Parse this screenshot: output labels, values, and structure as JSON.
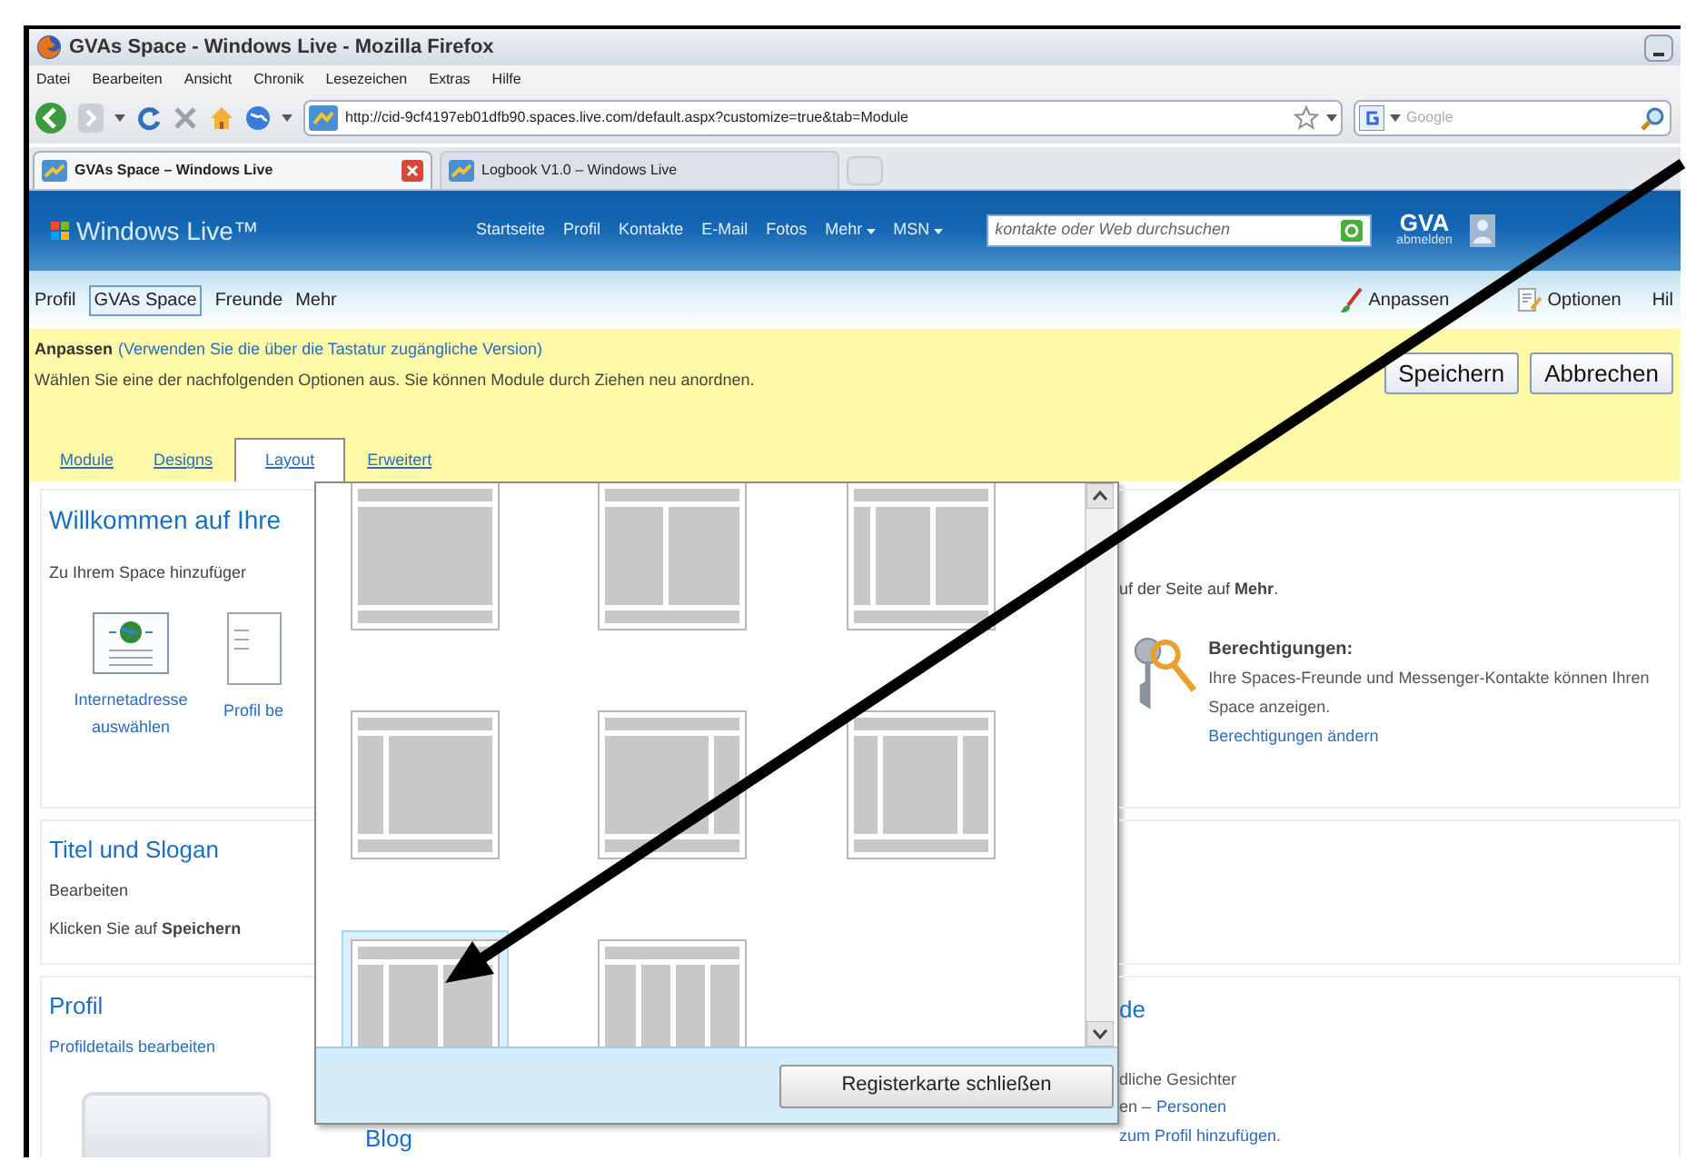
{
  "window": {
    "title": "GVAs Space - Windows Live - Mozilla Firefox"
  },
  "menu": [
    "Datei",
    "Bearbeiten",
    "Ansicht",
    "Chronik",
    "Lesezeichen",
    "Extras",
    "Hilfe"
  ],
  "address_bar": {
    "value": "http://cid-9cf4197eb01dfb90.spaces.live.com/default.aspx?customize=true&tab=Module"
  },
  "search_box": {
    "placeholder": "Google"
  },
  "browser_tabs": [
    {
      "label": "GVAs Space – Windows Live",
      "selected": true
    },
    {
      "label": "Logbook V1.0 – Windows Live",
      "selected": false
    }
  ],
  "site_header": {
    "logo": "Windows Live™",
    "nav": [
      {
        "label": "Startseite",
        "dropdown": false
      },
      {
        "label": "Profil",
        "dropdown": false
      },
      {
        "label": "Kontakte",
        "dropdown": false
      },
      {
        "label": "E-Mail",
        "dropdown": false
      },
      {
        "label": "Fotos",
        "dropdown": false
      },
      {
        "label": "Mehr",
        "dropdown": true
      },
      {
        "label": "MSN",
        "dropdown": true
      }
    ],
    "search": {
      "placeholder": "kontakte oder Web durchsuchen"
    },
    "user": "GVA",
    "signout": "abmelden"
  },
  "space_nav": {
    "items": [
      {
        "label": "Profil",
        "selected": false
      },
      {
        "label": "GVAs Space",
        "selected": true
      },
      {
        "label": "Freunde",
        "selected": false
      },
      {
        "label": "Mehr",
        "selected": false
      }
    ],
    "tools": [
      {
        "kind": "brush",
        "label": "Anpassen"
      },
      {
        "kind": "options",
        "label": "Optionen"
      },
      {
        "kind": "plain",
        "label": "Hil"
      }
    ]
  },
  "customize_bar": {
    "title": "Anpassen",
    "link": "(Verwenden Sie die über die Tastatur zugängliche Version)",
    "hint": "Wählen Sie eine der nachfolgenden Optionen aus. Sie können Module durch Ziehen neu anordnen.",
    "buttons": [
      "Speichern",
      "Abbrechen"
    ],
    "tabs": [
      {
        "label": "Module",
        "selected": false
      },
      {
        "label": "Designs",
        "selected": false
      },
      {
        "label": "Layout",
        "selected": true
      },
      {
        "label": "Erweitert",
        "selected": false
      }
    ]
  },
  "layout_panel": {
    "thumbnails": [
      {
        "kind": "single",
        "selected": false
      },
      {
        "kind": "halves",
        "selected": false
      },
      {
        "kind": "narrow-wide-wide",
        "selected": false
      },
      {
        "kind": "narrow-left",
        "selected": false
      },
      {
        "kind": "narrow-right",
        "selected": false
      },
      {
        "kind": "narrow-wide-narrow",
        "selected": false
      },
      {
        "kind": "three",
        "selected": true
      },
      {
        "kind": "four",
        "selected": false
      }
    ],
    "close_button": "Registerkarte schließen"
  },
  "welcome_module": {
    "title": "Willkommen auf Ihre",
    "intro": "Zu Ihrem Space hinzufüger",
    "actions": [
      {
        "kind": "web-address",
        "label": "Internetadresse auswählen"
      },
      {
        "kind": "profile",
        "label": "Profil be"
      }
    ],
    "text": "uf der Seite auf **Mehr**.",
    "permissions": {
      "title": "Berechtigungen:",
      "text": "Ihre Spaces-Freunde und Messenger-Kontakte können Ihren Space anzeigen.",
      "link": "Berechtigungen ändern"
    }
  },
  "title_module": {
    "title": "Titel und Slogan",
    "link": "Bearbeiten",
    "text": "Klicken Sie auf **Speichern**"
  },
  "profile_module": {
    "title": "Profil",
    "link": "Profildetails bearbeiten"
  },
  "blog_module": {
    "title": "Blog"
  },
  "friends_module": {
    "title": "de",
    "caption": "dliche Gesichter",
    "prefix": "en –",
    "links": [
      "Personen",
      "zum Profil hinzufügen."
    ]
  }
}
